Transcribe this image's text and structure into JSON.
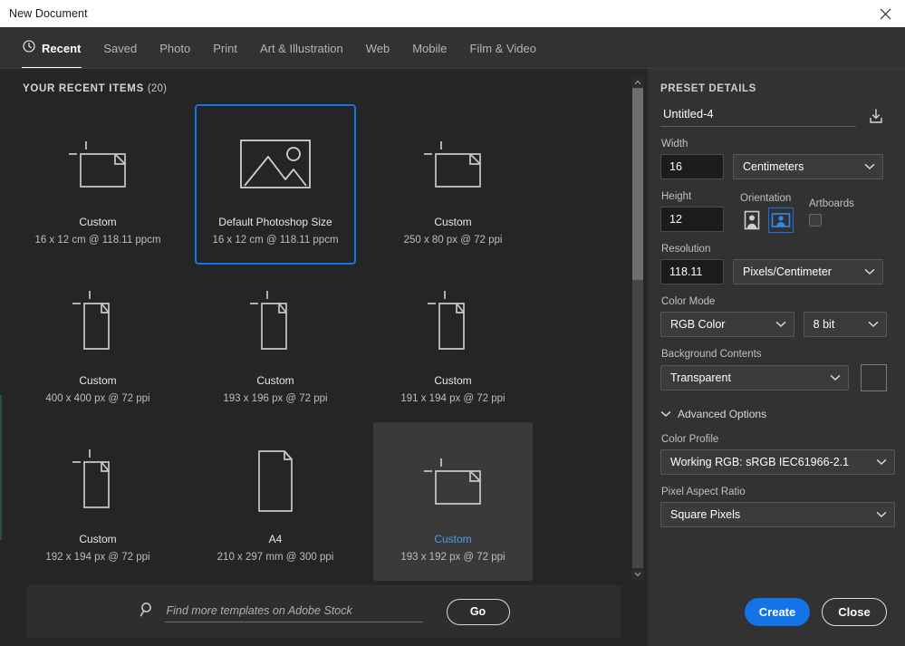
{
  "window": {
    "title": "New Document",
    "close_icon": "close-icon"
  },
  "tabs": [
    {
      "label": "Recent",
      "icon": "clock-icon",
      "active": true
    },
    {
      "label": "Saved",
      "active": false
    },
    {
      "label": "Photo",
      "active": false
    },
    {
      "label": "Print",
      "active": false
    },
    {
      "label": "Art & Illustration",
      "active": false
    },
    {
      "label": "Web",
      "active": false
    },
    {
      "label": "Mobile",
      "active": false
    },
    {
      "label": "Film & Video",
      "active": false
    }
  ],
  "recent": {
    "header": "YOUR RECENT ITEMS",
    "count": "(20)",
    "items": [
      {
        "title": "Custom",
        "sub": "16 x 12 cm @ 118.11 ppcm",
        "thumb": "landscape-doc-icon",
        "state": "normal"
      },
      {
        "title": "Default Photoshop Size",
        "sub": "16 x 12 cm @ 118.11 ppcm",
        "thumb": "image-photo-icon",
        "state": "selected"
      },
      {
        "title": "Custom",
        "sub": "250 x 80 px @ 72 ppi",
        "thumb": "landscape-doc-icon",
        "state": "normal"
      },
      {
        "title": "Custom",
        "sub": "400 x 400 px @ 72 ppi",
        "thumb": "portrait-doc-icon",
        "state": "normal"
      },
      {
        "title": "Custom",
        "sub": "193 x 196 px @ 72 ppi",
        "thumb": "portrait-doc-icon",
        "state": "normal"
      },
      {
        "title": "Custom",
        "sub": "191 x 194 px @ 72 ppi",
        "thumb": "portrait-doc-icon",
        "state": "normal"
      },
      {
        "title": "Custom",
        "sub": "192 x 194 px @ 72 ppi",
        "thumb": "portrait-doc-icon",
        "state": "normal"
      },
      {
        "title": "A4",
        "sub": "210 x 297 mm @ 300 ppi",
        "thumb": "page-doc-icon",
        "state": "normal"
      },
      {
        "title": "Custom",
        "sub": "193 x 192 px @ 72 ppi",
        "thumb": "landscape-doc-icon",
        "state": "hovered"
      }
    ]
  },
  "search": {
    "placeholder": "Find more templates on Adobe Stock",
    "value": "",
    "icon": "search-icon",
    "go_label": "Go"
  },
  "preset": {
    "title": "PRESET DETAILS",
    "name_value": "Untitled-4",
    "save_icon": "save-preset-icon",
    "width_label": "Width",
    "width_value": "16",
    "width_unit": "Centimeters",
    "height_label": "Height",
    "height_value": "12",
    "orientation_label": "Orientation",
    "orientation_portrait_icon": "portrait-orientation-icon",
    "orientation_landscape_icon": "landscape-orientation-icon",
    "orientation_selected": "landscape",
    "artboards_label": "Artboards",
    "artboards_checked": false,
    "resolution_label": "Resolution",
    "resolution_value": "118.11",
    "resolution_unit": "Pixels/Centimeter",
    "color_mode_label": "Color Mode",
    "color_mode_value": "RGB Color",
    "bit_depth_value": "8 bit",
    "background_label": "Background Contents",
    "background_value": "Transparent",
    "advanced_label": "Advanced Options",
    "advanced_expanded": true,
    "color_profile_label": "Color Profile",
    "color_profile_value": "Working RGB: sRGB IEC61966-2.1",
    "par_label": "Pixel Aspect Ratio",
    "par_value": "Square Pixels",
    "create_label": "Create",
    "close_label": "Close"
  },
  "colors": {
    "accent": "#1473e6",
    "panel_bg": "#323232",
    "content_bg": "#252525",
    "titlebar_bg": "#ffffff"
  },
  "scrollbar": {
    "thumb_percent": 40
  }
}
